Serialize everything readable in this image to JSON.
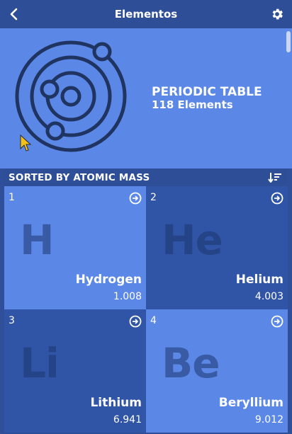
{
  "header": {
    "title": "Elementos",
    "back_icon": "chevron-left-icon",
    "settings_icon": "gear-icon"
  },
  "hero": {
    "title": "PERIODIC TABLE",
    "subtitle": "118 Elements",
    "icon": "atom-icon"
  },
  "sort": {
    "label": "SORTED BY ATOMIC MASS",
    "icon": "sort-descending-icon"
  },
  "elements": [
    {
      "number": "1",
      "symbol": "H",
      "name": "Hydrogen",
      "mass": "1.008",
      "tone": "light"
    },
    {
      "number": "2",
      "symbol": "He",
      "name": "Helium",
      "mass": "4.003",
      "tone": "dark"
    },
    {
      "number": "3",
      "symbol": "Li",
      "name": "Lithium",
      "mass": "6.941",
      "tone": "dark"
    },
    {
      "number": "4",
      "symbol": "Be",
      "name": "Beryllium",
      "mass": "9.012",
      "tone": "light"
    }
  ],
  "colors": {
    "header_bg": "#2e4f98",
    "hero_bg": "#5b87e6",
    "tile_light": "#5b87e6",
    "tile_dark": "#3055a6",
    "cursor": "#f2c21b"
  }
}
